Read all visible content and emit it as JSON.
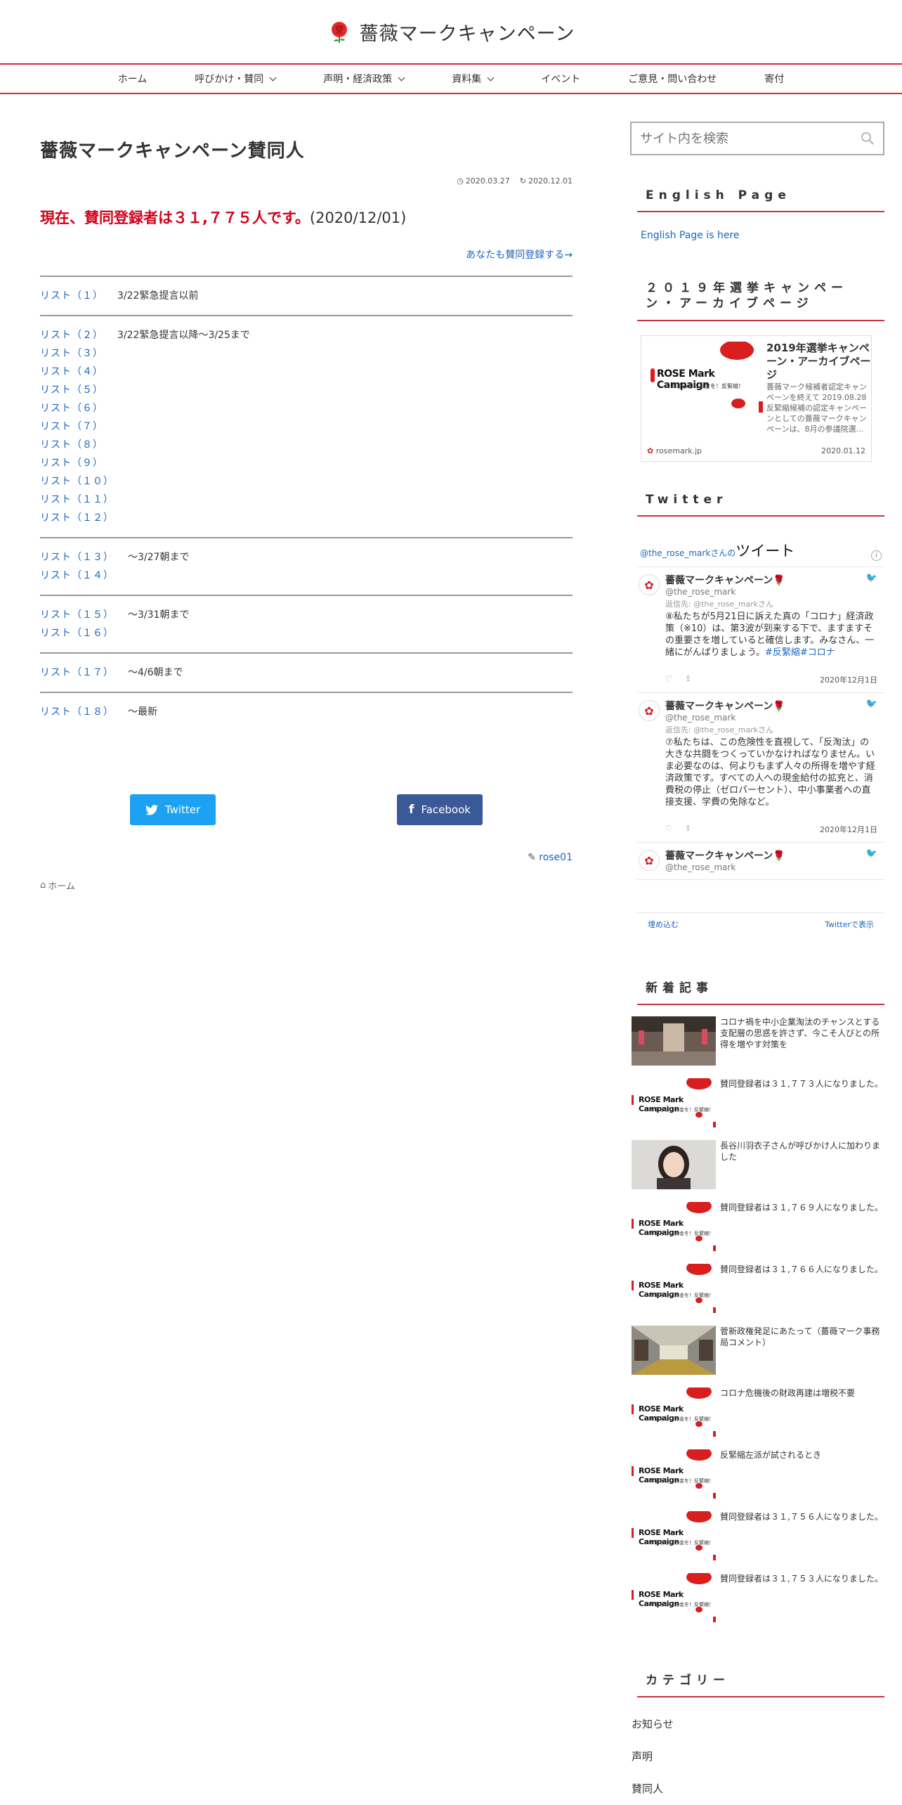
{
  "site": {
    "title": "薔薇マークキャンペーン"
  },
  "nav": [
    {
      "label": "ホーム",
      "has_dropdown": false
    },
    {
      "label": "呼びかけ・賛同",
      "has_dropdown": true
    },
    {
      "label": "声明・経済政策",
      "has_dropdown": true
    },
    {
      "label": "資料集",
      "has_dropdown": true
    },
    {
      "label": "イベント",
      "has_dropdown": false
    },
    {
      "label": "ご意見・問い合わせ",
      "has_dropdown": false
    },
    {
      "label": "寄付",
      "has_dropdown": false
    }
  ],
  "article": {
    "title": "薔薇マークキャンペーン賛同人",
    "published": "2020.03.27",
    "updated": "2020.12.01",
    "count_red": "現在、賛同登録者は３１,７７５人です。",
    "count_date": "(2020/12/01)",
    "join_link": "あなたも賛同登録する→",
    "groups": [
      {
        "rows": [
          {
            "link": "リスト（１）",
            "note": "3/22緊急提言以前"
          }
        ]
      },
      {
        "rows": [
          {
            "link": "リスト（２）",
            "note": "3/22緊急提言以降～3/25まで"
          },
          {
            "link": "リスト（３）",
            "note": ""
          },
          {
            "link": "リスト（４）",
            "note": ""
          },
          {
            "link": "リスト（５）",
            "note": ""
          },
          {
            "link": "リスト（６）",
            "note": ""
          },
          {
            "link": "リスト（７）",
            "note": ""
          },
          {
            "link": "リスト（８）",
            "note": ""
          },
          {
            "link": "リスト（９）",
            "note": ""
          },
          {
            "link": "リスト（１０）",
            "note": ""
          },
          {
            "link": "リスト（１１）",
            "note": ""
          },
          {
            "link": "リスト（１２）",
            "note": ""
          }
        ]
      },
      {
        "rows": [
          {
            "link": "リスト（１３）",
            "note": "～3/27朝まで"
          },
          {
            "link": "リスト（１４）",
            "note": ""
          }
        ]
      },
      {
        "rows": [
          {
            "link": "リスト（１５）",
            "note": "～3/31朝まで"
          },
          {
            "link": "リスト（１６）",
            "note": ""
          }
        ]
      },
      {
        "rows": [
          {
            "link": "リスト（１７）",
            "note": "～4/6朝まで"
          }
        ]
      },
      {
        "rows": [
          {
            "link": "リスト（１８）",
            "note": "～最新"
          }
        ]
      }
    ],
    "share_twitter": "Twitter",
    "share_facebook": "Facebook",
    "author": "rose01",
    "breadcrumb_home": "ホーム"
  },
  "sidebar": {
    "search_placeholder": "サイト内を検索",
    "english_title": "English Page",
    "english_link": "English Page is here",
    "archive_title": "２０１９年選挙キャンペーン・アーカイブページ",
    "card": {
      "image_text": "ROSE Mark Campaign",
      "image_sub": "＃暮らしにお金を！反緊縮！",
      "title": "2019年選挙キャンペーン・アーカイブページ",
      "desc": "薔薇マーク候補者認定キャンペーンを終えて 2019.08.28 反緊縮候補の認定キャンペーンとしての薔薇マークキャンペーンは、8月の参議院選...",
      "site": "rosemark.jp",
      "date": "2020.01.12"
    },
    "twitter_title": "Twitter",
    "timeline": {
      "handle_prefix": "@the_rose_markさんの",
      "label": "ツイート",
      "tweets": [
        {
          "name": "薔薇マークキャンペーン🌹",
          "handle": "@the_rose_mark",
          "reply": "返信先: @the_rose_markさん",
          "text": "⑧私たちが5月21日に訴えた真の「コロナ」経済政策（※10）は、第3波が到来する下で、ますますその重要さを増していると確信します。みなさん、一緒にがんばりましょう。",
          "hashtags": "#反緊縮#コロナ",
          "date": "2020年12月1日"
        },
        {
          "name": "薔薇マークキャンペーン🌹",
          "handle": "@the_rose_mark",
          "reply": "返信先: @the_rose_markさん",
          "text": "⑦私たちは、この危険性を直視して、「反淘汰」の大きな共闘をつくっていかなければなりません。いま必要なのは、何よりもまず人々の所得を増やす経済政策です。すべての人への現金給付の拡充と、消費税の停止（ゼロパーセント）、中小事業者への直接支援、学費の免除など。",
          "hashtags": "",
          "date": "2020年12月1日"
        },
        {
          "name": "薔薇マークキャンペーン🌹",
          "handle": "@the_rose_mark",
          "reply": "",
          "text": "",
          "hashtags": "",
          "date": ""
        }
      ],
      "embed": "埋め込む",
      "view": "Twitterで表示"
    },
    "new_title": "新着記事",
    "new_items": [
      {
        "text": "コロナ禍を中小企業淘汰のチャンスとする支配層の思惑を許さず、今こそ人びとの所得を増やす対策を",
        "thumb": "street"
      },
      {
        "text": "賛同登録者は３１,７７３人になりました。",
        "thumb": "logo"
      },
      {
        "text": "長谷川羽衣子さんが呼びかけ人に加わりました",
        "thumb": "person"
      },
      {
        "text": "賛同登録者は３１,７６９人になりました。",
        "thumb": "logo"
      },
      {
        "text": "賛同登録者は３１,７６６人になりました。",
        "thumb": "logo"
      },
      {
        "text": "菅新政権発足にあたって（薔薇マーク事務局コメント）",
        "thumb": "arcade"
      },
      {
        "text": "コロナ危機後の財政再建は増税不要",
        "thumb": "logo"
      },
      {
        "text": "反緊縮左派が試されるとき",
        "thumb": "logo"
      },
      {
        "text": "賛同登録者は３１,７５６人になりました。",
        "thumb": "logo"
      },
      {
        "text": "賛同登録者は３１,７５３人になりました。",
        "thumb": "logo"
      }
    ],
    "logo_thumb_text": "ROSE Mark Campaign",
    "logo_thumb_sub": "＃暮らしにお金を！反緊縮！",
    "category_title": "カテゴリー",
    "categories": [
      "お知らせ",
      "声明",
      "賛同人"
    ]
  },
  "colors": {
    "accent": "#c8333f",
    "link": "#1a66c0",
    "highlight": "#d0021b",
    "twitter": "#1da1f2",
    "facebook": "#3b5998"
  }
}
